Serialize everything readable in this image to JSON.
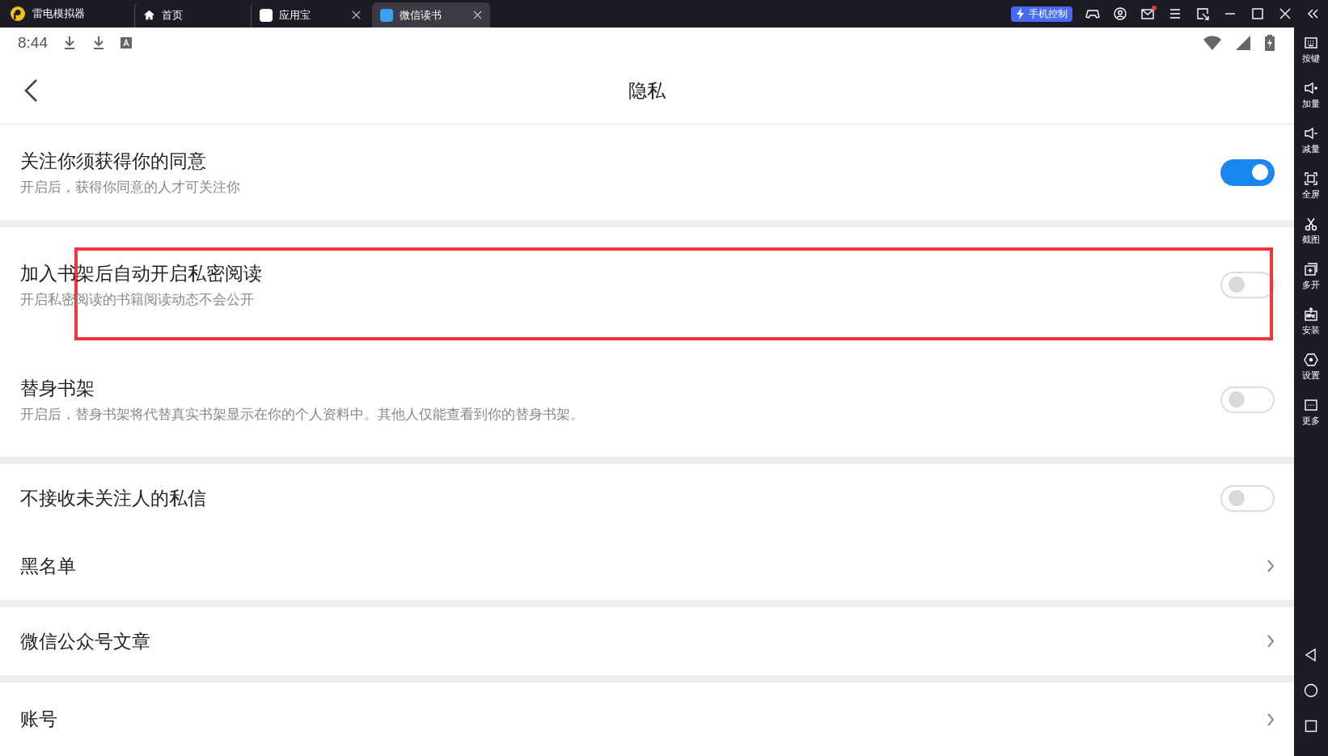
{
  "titlebar": {
    "app_name": "雷电模拟器",
    "tabs": [
      {
        "label": "首页",
        "kind": "home",
        "selected": false,
        "closable": false
      },
      {
        "label": "应用宝",
        "kind": "app",
        "selected": false,
        "closable": true
      },
      {
        "label": "微信读书",
        "kind": "app",
        "selected": true,
        "closable": true
      }
    ],
    "phone_control": "手机控制",
    "mail_unread": true
  },
  "status_bar": {
    "time": "8:44"
  },
  "header": {
    "title": "隐私"
  },
  "groups": [
    [
      {
        "kind": "toggle",
        "title": "关注你须获得你的同意",
        "subtitle": "开启后，获得你同意的人才可关注你",
        "on": true,
        "highlighted": false
      }
    ],
    [
      {
        "kind": "toggle",
        "title": "加入书架后自动开启私密阅读",
        "subtitle": "开启私密阅读的书籍阅读动态不会公开",
        "on": false,
        "highlighted": true
      },
      {
        "kind": "toggle",
        "title": "替身书架",
        "subtitle": "开启后，替身书架将代替真实书架显示在你的个人资料中。其他人仅能查看到你的替身书架。",
        "on": false,
        "highlighted": false
      }
    ],
    [
      {
        "kind": "toggle",
        "title": "不接收未关注人的私信",
        "on": false,
        "highlighted": false
      },
      {
        "kind": "link",
        "title": "黑名单",
        "highlighted": false
      }
    ],
    [
      {
        "kind": "link",
        "title": "微信公众号文章",
        "highlighted": false
      }
    ],
    [
      {
        "kind": "link",
        "title": "账号",
        "highlighted": false
      }
    ]
  ],
  "sidebar": {
    "items": [
      {
        "label": "按键"
      },
      {
        "label": "加量"
      },
      {
        "label": "减量"
      },
      {
        "label": "全屏"
      },
      {
        "label": "截图"
      },
      {
        "label": "多开"
      },
      {
        "label": "安装"
      },
      {
        "label": "设置"
      },
      {
        "label": "更多"
      }
    ]
  }
}
